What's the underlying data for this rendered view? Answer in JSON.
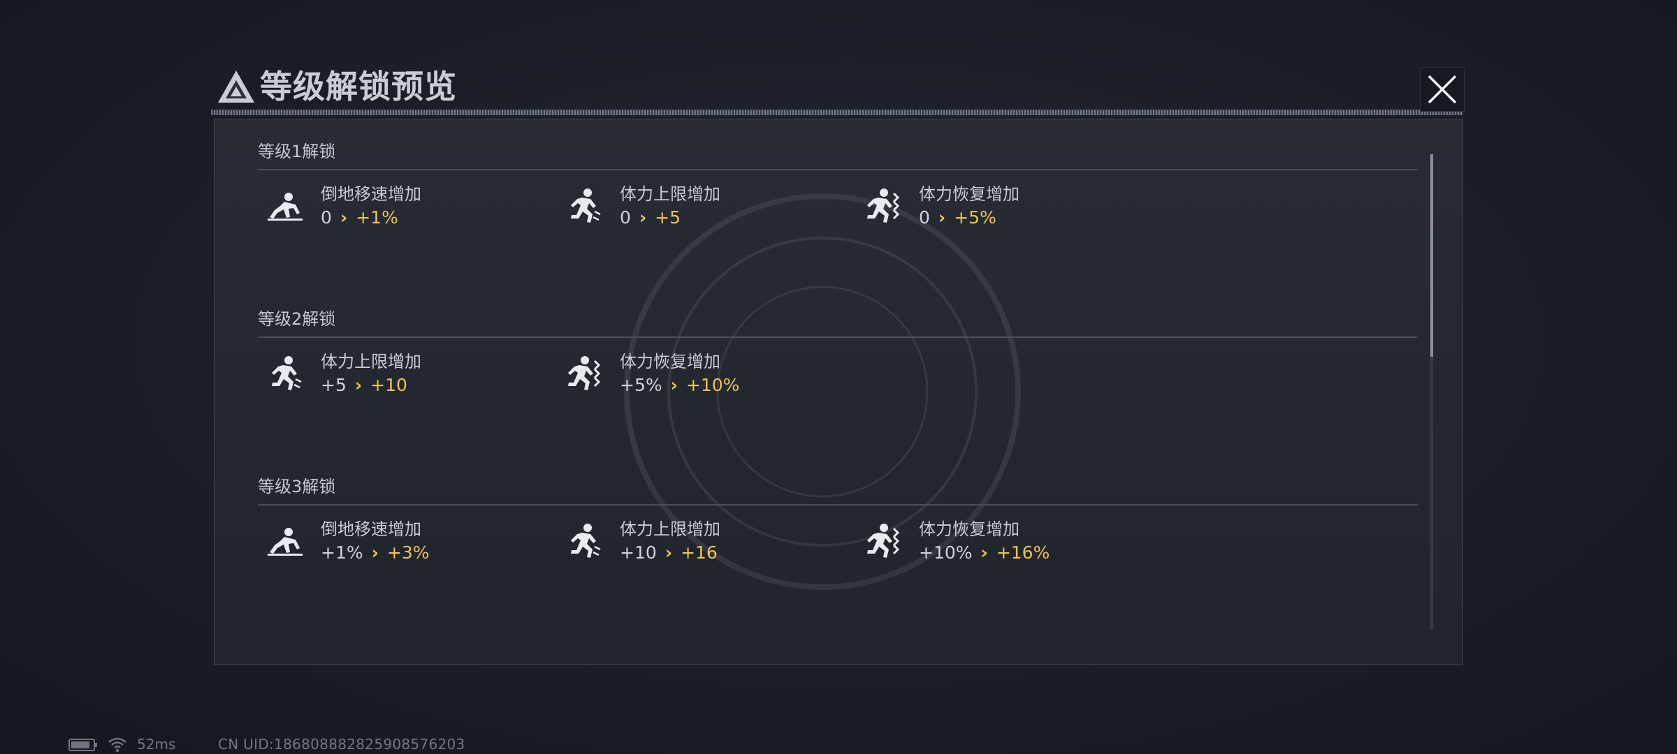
{
  "dialog": {
    "title": "等级解锁预览",
    "logo_icon": "triangle-emblem-icon",
    "close_icon": "close-x-icon"
  },
  "sections": [
    {
      "title": "等级1解锁",
      "items": [
        {
          "icon": "crawl-icon",
          "name": "倒地移速增加",
          "from": "0",
          "to": "+1%"
        },
        {
          "icon": "sprint-icon",
          "name": "体力上限增加",
          "from": "0",
          "to": "+5"
        },
        {
          "icon": "sprint-recovery-icon",
          "name": "体力恢复增加",
          "from": "0",
          "to": "+5%"
        }
      ]
    },
    {
      "title": "等级2解锁",
      "items": [
        {
          "icon": "sprint-icon",
          "name": "体力上限增加",
          "from": "+5",
          "to": "+10"
        },
        {
          "icon": "sprint-recovery-icon",
          "name": "体力恢复增加",
          "from": "+5%",
          "to": "+10%"
        }
      ]
    },
    {
      "title": "等级3解锁",
      "items": [
        {
          "icon": "crawl-icon",
          "name": "倒地移速增加",
          "from": "+1%",
          "to": "+3%"
        },
        {
          "icon": "sprint-icon",
          "name": "体力上限增加",
          "from": "+10",
          "to": "+16"
        },
        {
          "icon": "sprint-recovery-icon",
          "name": "体力恢复增加",
          "from": "+10%",
          "to": "+16%"
        }
      ]
    }
  ],
  "arrow_glyph": "›",
  "status": {
    "ping": "52ms",
    "uid": "CN UID:186808882825908576203",
    "battery_icon": "battery-icon",
    "wifi_icon": "wifi-icon"
  },
  "colors": {
    "accent": "#f1c24c",
    "text": "#c9ccd1",
    "panel": "#242830",
    "background": "#181c24"
  }
}
